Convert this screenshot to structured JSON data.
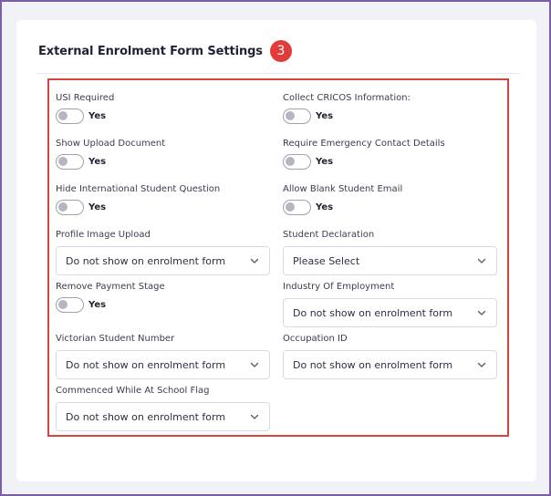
{
  "section": {
    "title": "External Enrolment Form Settings",
    "step": "3"
  },
  "toggle_text": "Yes",
  "fields": {
    "usi_required": {
      "label": "USI Required",
      "value": "Yes",
      "on": false
    },
    "collect_cricos": {
      "label": "Collect CRICOS Information:",
      "value": "Yes",
      "on": false
    },
    "show_upload_document": {
      "label": "Show Upload Document",
      "value": "Yes",
      "on": false
    },
    "require_emergency": {
      "label": "Require Emergency Contact Details",
      "value": "Yes",
      "on": false
    },
    "hide_international": {
      "label": "Hide International Student Question",
      "value": "Yes",
      "on": false
    },
    "allow_blank_email": {
      "label": "Allow Blank Student Email",
      "value": "Yes",
      "on": false
    },
    "profile_image_upload": {
      "label": "Profile Image Upload",
      "value": "Do not show on enrolment form"
    },
    "student_declaration": {
      "label": "Student Declaration",
      "value": "Please Select"
    },
    "remove_payment_stage": {
      "label": "Remove Payment Stage",
      "value": "Yes",
      "on": false
    },
    "industry_of_employment": {
      "label": "Industry Of Employment",
      "value": "Do not show on enrolment form"
    },
    "victorian_student_number": {
      "label": "Victorian Student Number",
      "value": "Do not show on enrolment form"
    },
    "occupation_id": {
      "label": "Occupation ID",
      "value": "Do not show on enrolment form"
    },
    "commenced_while_at_school": {
      "label": "Commenced While At School Flag",
      "value": "Do not show on enrolment form"
    }
  },
  "colors": {
    "frame_border": "#7b5ea7",
    "highlight": "#d9433d",
    "badge": "#e23b3b"
  }
}
